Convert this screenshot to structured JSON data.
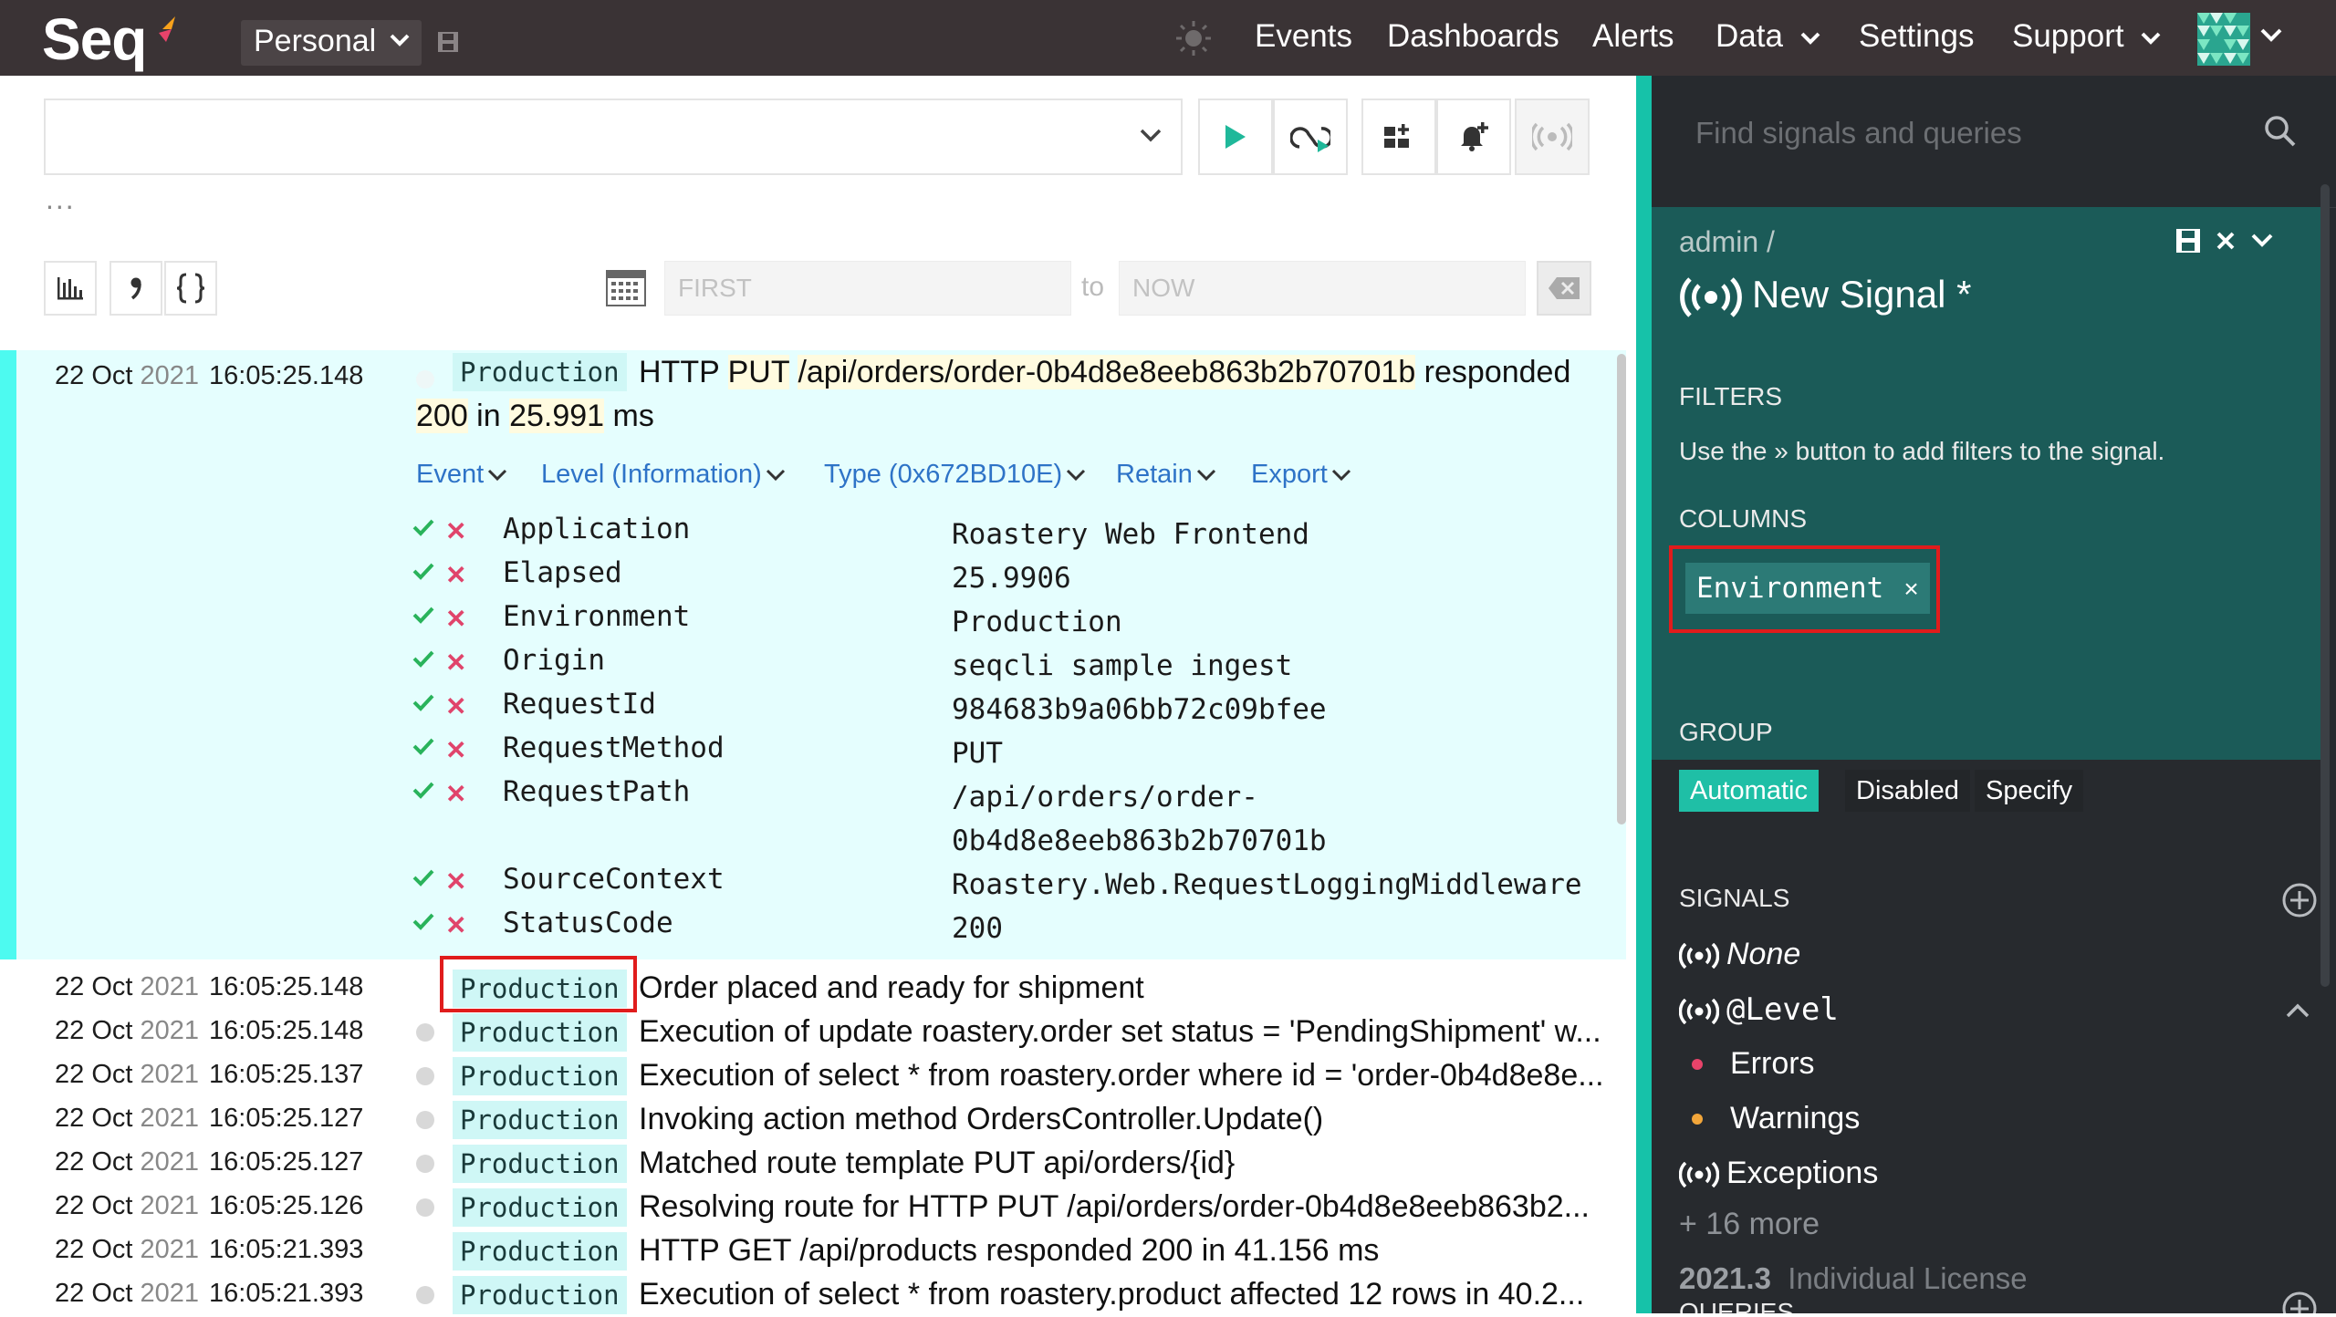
{
  "topbar": {
    "logo": "Seq",
    "workspace": "Personal",
    "nav": [
      {
        "label": "Events",
        "dropdown": false
      },
      {
        "label": "Dashboards",
        "dropdown": false
      },
      {
        "label": "Alerts",
        "dropdown": false
      },
      {
        "label": "Data",
        "dropdown": true
      },
      {
        "label": "Settings",
        "dropdown": false
      },
      {
        "label": "Support",
        "dropdown": true
      }
    ]
  },
  "query": {
    "value": "",
    "ellipsis": "...",
    "date_from_placeholder": "FIRST",
    "date_to_label": "to",
    "date_to_placeholder": "NOW"
  },
  "expanded_event": {
    "date": "22 Oct",
    "year": "2021",
    "time": "16:05:25.148",
    "environment": "Production",
    "message_parts": [
      "HTTP ",
      "PUT",
      " ",
      "/api/orders/order-0b4d8e8eeb863b2b70701b",
      " responded"
    ],
    "message_line2_parts": [
      "200",
      " in ",
      "25.991",
      " ms"
    ],
    "menu": [
      "Event",
      "Level (Information)",
      "Type (0x672BD10E)",
      "Retain",
      "Export"
    ],
    "properties": [
      {
        "name": "Application",
        "value": "Roastery Web Frontend"
      },
      {
        "name": "Elapsed",
        "value": "25.9906"
      },
      {
        "name": "Environment",
        "value": "Production"
      },
      {
        "name": "Origin",
        "value": "seqcli sample ingest"
      },
      {
        "name": "RequestId",
        "value": "984683b9a06bb72c09bfee"
      },
      {
        "name": "RequestMethod",
        "value": "PUT"
      },
      {
        "name": "RequestPath",
        "value": "/api/orders/order-",
        "value2": "0b4d8e8eeb863b2b70701b"
      },
      {
        "name": "SourceContext",
        "value": "Roastery.Web.RequestLoggingMiddleware"
      },
      {
        "name": "StatusCode",
        "value": "200"
      }
    ]
  },
  "events": [
    {
      "date": "22 Oct",
      "year": "2021",
      "time": "16:05:25.148",
      "environment": "Production",
      "message": "Order placed and ready for shipment"
    },
    {
      "date": "22 Oct",
      "year": "2021",
      "time": "16:05:25.148",
      "environment": "Production",
      "message": "Execution of update roastery.order set status = 'PendingShipment' w..."
    },
    {
      "date": "22 Oct",
      "year": "2021",
      "time": "16:05:25.137",
      "environment": "Production",
      "message": "Execution of select * from roastery.order where id = 'order-0b4d8e8e..."
    },
    {
      "date": "22 Oct",
      "year": "2021",
      "time": "16:05:25.127",
      "environment": "Production",
      "message": "Invoking action method OrdersController.Update()"
    },
    {
      "date": "22 Oct",
      "year": "2021",
      "time": "16:05:25.127",
      "environment": "Production",
      "message": "Matched route template PUT api/orders/{id}"
    },
    {
      "date": "22 Oct",
      "year": "2021",
      "time": "16:05:25.126",
      "environment": "Production",
      "message": "Resolving route for HTTP PUT /api/orders/order-0b4d8e8eeb863b2..."
    },
    {
      "date": "22 Oct",
      "year": "2021",
      "time": "16:05:21.393",
      "environment": "Production",
      "message": "HTTP GET /api/products responded 200 in 41.156 ms"
    },
    {
      "date": "22 Oct",
      "year": "2021",
      "time": "16:05:21.393",
      "environment": "Production",
      "message": "Execution of select * from roastery.product affected 12 rows in 40.2..."
    }
  ],
  "signal_panel": {
    "search_placeholder": "Find signals and queries",
    "breadcrumb": "admin /",
    "title": "New Signal *",
    "filters_heading": "FILTERS",
    "filters_help": "Use the » button to add filters to the signal.",
    "columns_heading": "COLUMNS",
    "column_chip": "Environment",
    "column_chip_remove": "×",
    "group_heading": "GROUP",
    "group_options": [
      "Automatic",
      "Disabled",
      "Specify"
    ],
    "group_selected": "Automatic",
    "signals_heading": "SIGNALS",
    "signals": {
      "none": "None",
      "level": "@Level",
      "errors": "Errors",
      "warnings": "Warnings",
      "exceptions": "Exceptions",
      "more": "+ 16 more"
    },
    "queries_heading": "QUERIES",
    "version": "2021.3",
    "license": "Individual License"
  },
  "colors": {
    "topbar": "#3a3335",
    "accent": "#16c2a9",
    "signal_panel": "#1b5b58",
    "error_dot": "#e8436a",
    "warning_dot": "#f2a63a",
    "highlight_box": "#e01c1c"
  }
}
